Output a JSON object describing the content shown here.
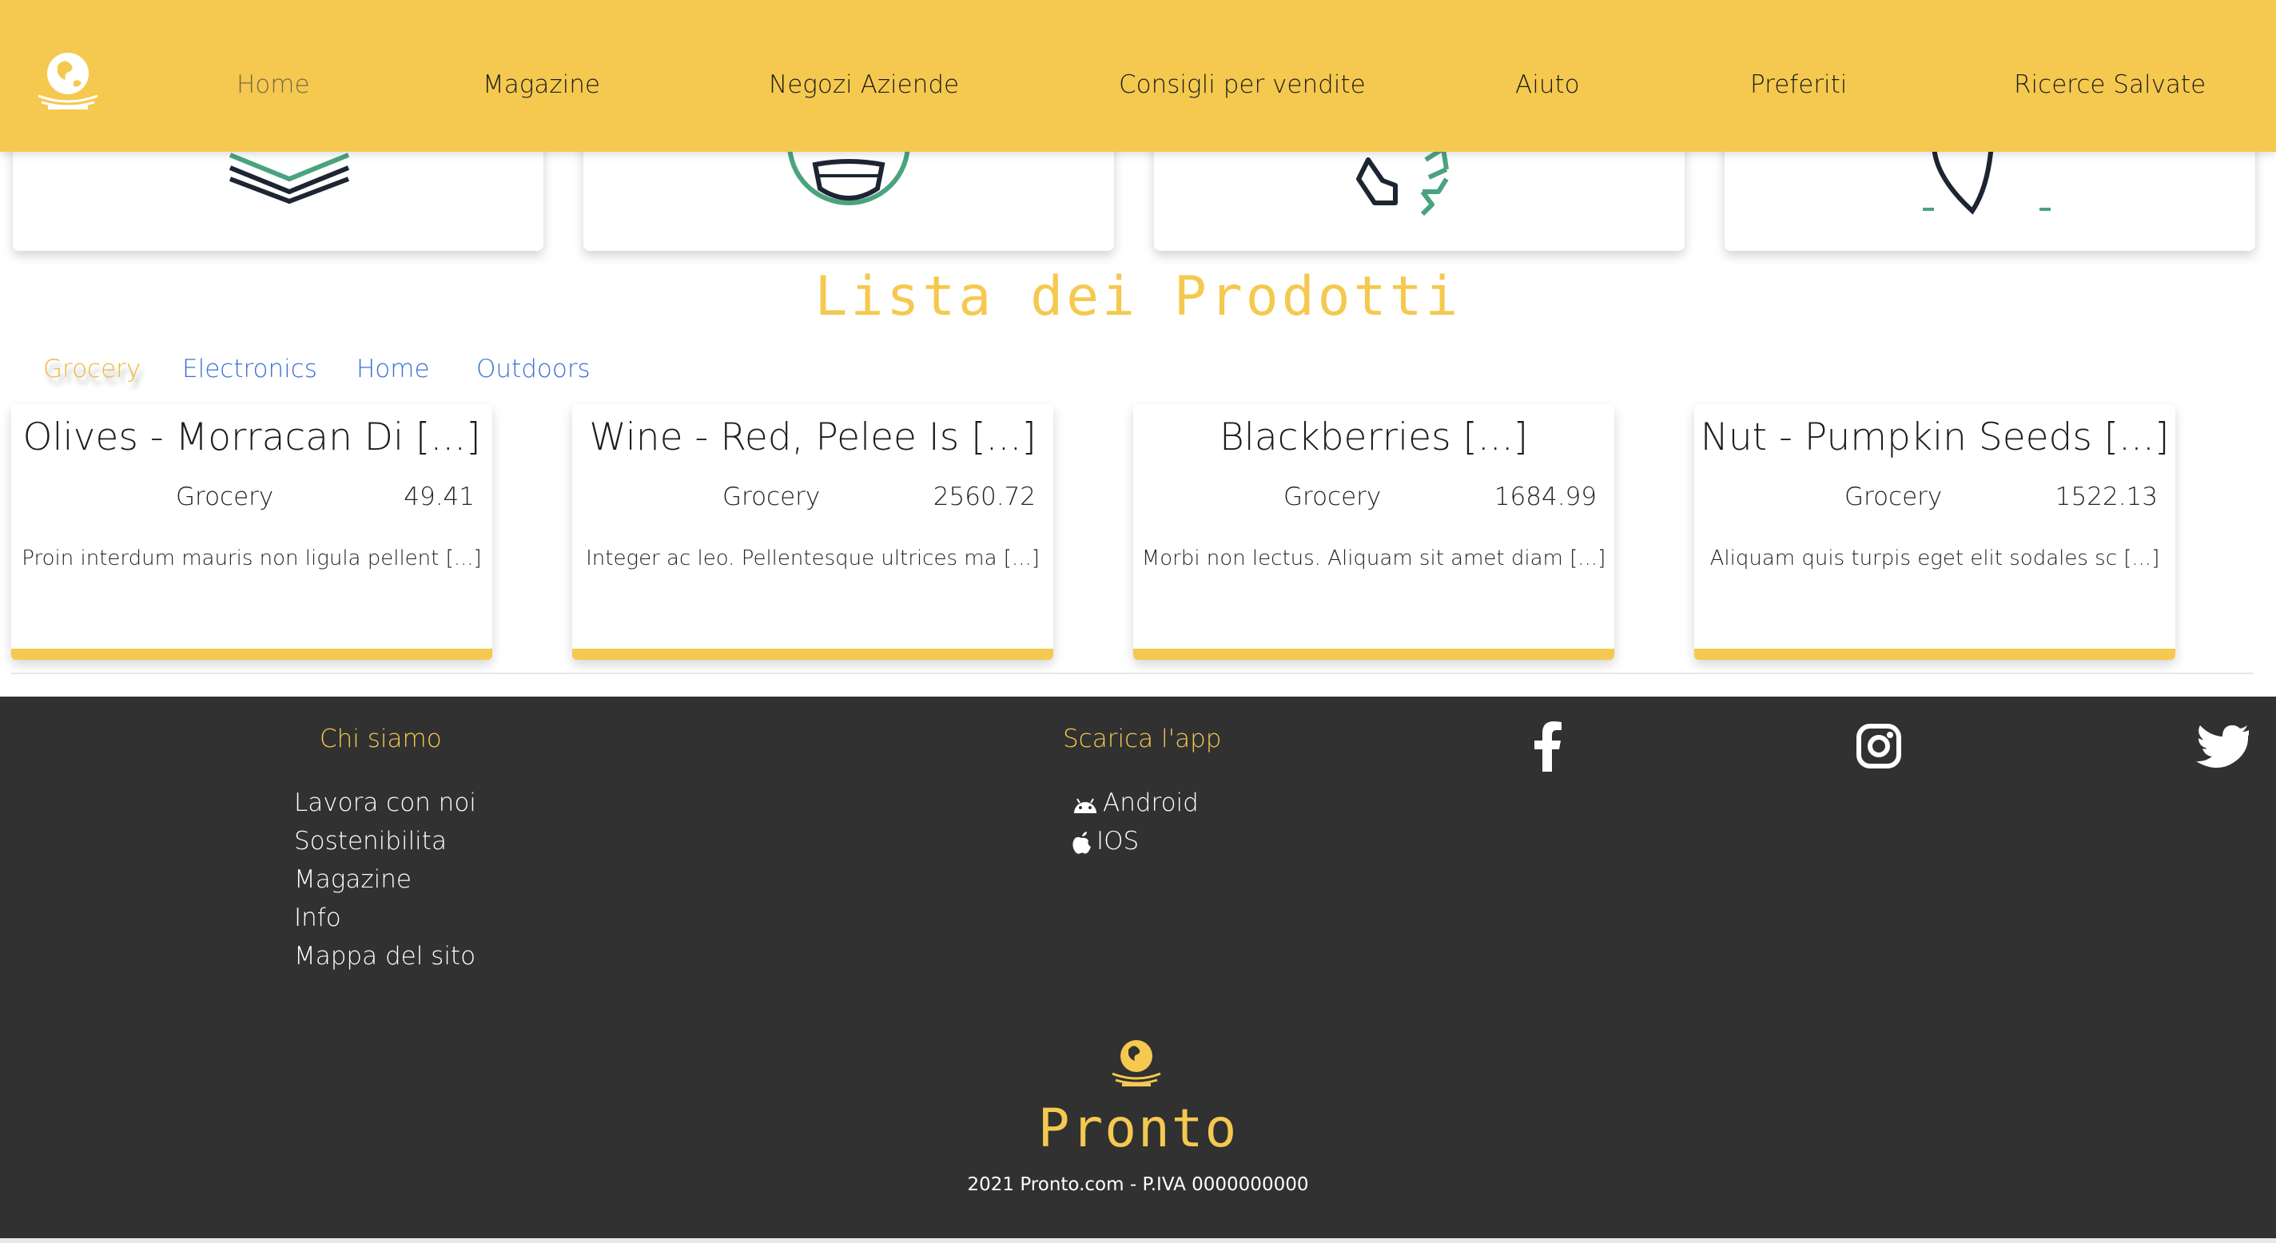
{
  "colors": {
    "accent": "#f5c94f",
    "footer_bg": "#313131",
    "tab_link": "#3a6fd8",
    "icon_green": "#4aa37f",
    "icon_dark": "#1d2533"
  },
  "nav": {
    "logo_icon": "globe-logo-icon",
    "items": [
      "Home",
      "Magazine",
      "Negozi Aziende",
      "Consigli per vendite",
      "Aiuto",
      "Preferiti",
      "Ricerce Salvate"
    ]
  },
  "features": [
    {
      "icon": "layers-icon"
    },
    {
      "icon": "face-mask-icon"
    },
    {
      "icon": "recycle-icon"
    },
    {
      "icon": "map-pin-icon"
    }
  ],
  "products_section": {
    "title": "Lista dei Prodotti",
    "tabs": [
      "Grocery",
      "Electronics",
      "Home",
      "Outdoors"
    ],
    "items": [
      {
        "name": "Olives - Morracan Di [...]",
        "category": "Grocery",
        "price": "49.41",
        "description": "Proin interdum mauris non ligula pellent [...]"
      },
      {
        "name": "Wine - Red, Pelee Is [...]",
        "category": "Grocery",
        "price": "2560.72",
        "description": "Integer ac leo. Pellentesque ultrices ma [...]"
      },
      {
        "name": "Blackberries [...]",
        "category": "Grocery",
        "price": "1684.99",
        "description": "Morbi non lectus. Aliquam sit amet diam [...]"
      },
      {
        "name": "Nut - Pumpkin Seeds [...]",
        "category": "Grocery",
        "price": "1522.13",
        "description": "Aliquam quis turpis eget elit sodales sc [...]"
      }
    ]
  },
  "footer": {
    "about": {
      "heading": "Chi siamo",
      "links": [
        "Lavora con noi",
        "Sostenibilita",
        "Magazine",
        "Info",
        "Mappa del sito"
      ]
    },
    "app": {
      "heading": "Scarica l'app",
      "links": [
        {
          "label": "Android",
          "icon": "android-icon"
        },
        {
          "label": "IOS",
          "icon": "apple-icon"
        }
      ]
    },
    "social": [
      "facebook-icon",
      "instagram-icon",
      "twitter-icon"
    ],
    "brand": "Pronto",
    "copyright": "2021 Pronto.com - P.IVA 0000000000"
  }
}
